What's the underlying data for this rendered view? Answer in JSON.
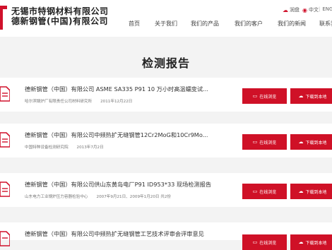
{
  "header": {
    "company_line1": "无锡市特钢材料有限公司",
    "company_line2": "德新钢管(中国)有限公司",
    "logo_letter": "T",
    "util": {
      "pan_label": "润盘",
      "lang_cn": "中文",
      "lang_en": "ENGLISH"
    },
    "nav": [
      "首页",
      "关于我们",
      "我们的产品",
      "我们的客户",
      "我们的新闻",
      "联系我们"
    ]
  },
  "page_title": "检测报告",
  "reports": [
    {
      "title": "德新钢管（中国）有限公司 ASME SA335 P91 10 万小时高温蠕变试...",
      "org": "哈尔滨锅炉厂有限责任公司材料研究所",
      "date": "2011年12月22日",
      "view_label": "在线浏览",
      "download_label": "下载到本地"
    },
    {
      "title": "德新钢管（中国）有限公司中频热扩无缝钢管12Cr2MoG和10Cr9Mo...",
      "org": "中国特种设备检测研究院",
      "date": "2013年7月2日",
      "view_label": "在线浏览",
      "download_label": "下载到本地"
    },
    {
      "title": "德新钢管（中国）有限公司供山东黄岛电厂P91 ID953*33 现场检测报告",
      "org": "山东电力工业锅炉压力容器检验中心",
      "date": "2007年9月21日、2009年1月20日 共2份",
      "view_label": "在线浏览",
      "download_label": "下载到本地"
    },
    {
      "title": "德新钢管（中国）有限公司中频热扩无缝钢管工艺技术评审会评审意见",
      "org": "",
      "date": "",
      "view_label": "在线浏览",
      "download_label": "下载到本地"
    }
  ],
  "colors": {
    "accent": "#cf1127",
    "page_bg": "#f3f3f3"
  },
  "icons": {
    "pan": "cloud-icon",
    "lang": "globe-icon",
    "doc": "pdf-document-icon",
    "view": "monitor-icon",
    "download": "cloud-download-icon"
  }
}
